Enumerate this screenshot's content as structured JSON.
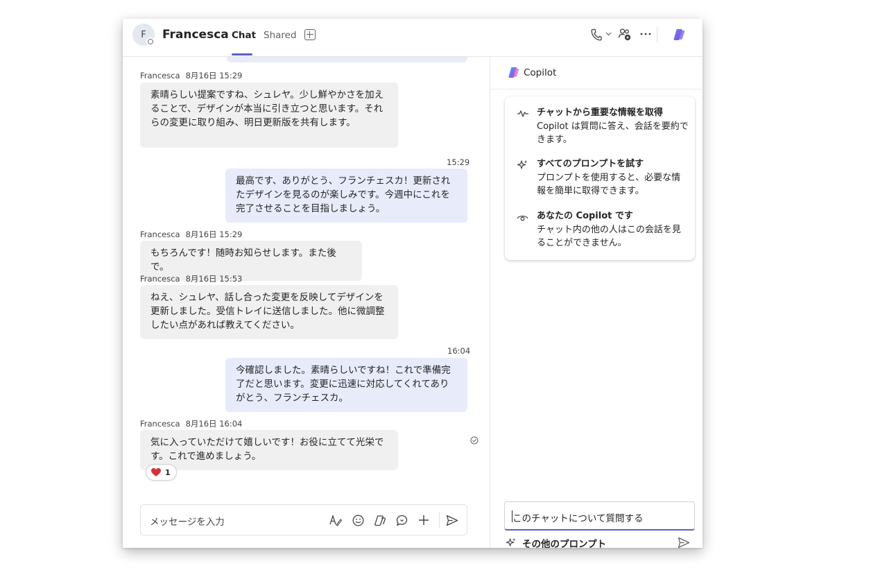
{
  "header": {
    "avatar_initial": "F",
    "contact_name": "Francesca",
    "tabs": [
      {
        "label": "Chat",
        "active": true
      },
      {
        "label": "Shared",
        "active": false
      }
    ],
    "icons": [
      "phone-icon",
      "chevron-down-icon",
      "people-icon",
      "more-icon",
      "copilot-icon"
    ]
  },
  "chat": {
    "messages": [
      {
        "direction": "in",
        "sender": "Francesca",
        "date": "8月16日",
        "time": "15:29",
        "text": "素晴らしい提案ですね、シュレヤ。少し鮮やかさを加えることで、デザインが本当に引き立つと思います。それらの変更に取り組み、明日更新版を共有します。"
      },
      {
        "direction": "out",
        "time": "15:29",
        "text": "最高です、ありがとう、フランチェスカ！更新されたデザインを見るのが楽しみです。今週中にこれを完了させることを目指しましょう。"
      },
      {
        "direction": "in",
        "sender": "Francesca",
        "date": "8月16日",
        "time": "15:29",
        "text": "もちろんです！随時お知らせします。また後で。"
      },
      {
        "direction": "in",
        "sender": "Francesca",
        "date": "8月16日",
        "time": "15:53",
        "text": "ねえ、シュレヤ、話し合った変更を反映してデザインを更新しました。受信トレイに送信しました。他に微調整したい点があれば教えてください。"
      },
      {
        "direction": "out",
        "time": "16:04",
        "text": "今確認しました。素晴らしいですね！これで準備完了だと思います。変更に迅速に対応してくれてありがとう、フランチェスカ。"
      },
      {
        "direction": "in",
        "sender": "Francesca",
        "date": "8月16日",
        "time": "16:04",
        "text": "気に入っていただけて嬉しいです！お役に立てて光栄です。これで進めましょう。"
      }
    ],
    "reaction": {
      "emoji": "heart-icon",
      "count": "1"
    },
    "compose_placeholder": "メッセージを入力"
  },
  "copilot": {
    "title": "Copilot",
    "features": [
      {
        "icon": "pulse-icon",
        "title": "チャットから重要な情報を取得",
        "desc": "Copilot は質問に答え、会話を要約できます。"
      },
      {
        "icon": "sparkle-icon",
        "title": "すべてのプロンプトを試す",
        "desc": "プロンプトを使用すると、必要な情報を簡単に取得できます。"
      },
      {
        "icon": "eye-icon",
        "title": "あなたの Copilot です",
        "desc": "チャット内の他の人はこの会話を見ることができません。"
      }
    ],
    "ask_value": "このチャットについて質問する",
    "more_prompts": "その他のプロンプト"
  },
  "colors": {
    "accent": "#5b5fc7",
    "outgoing_bubble": "#e8ebfa",
    "incoming_bubble": "#f0f0f0",
    "heart": "#d13438"
  }
}
